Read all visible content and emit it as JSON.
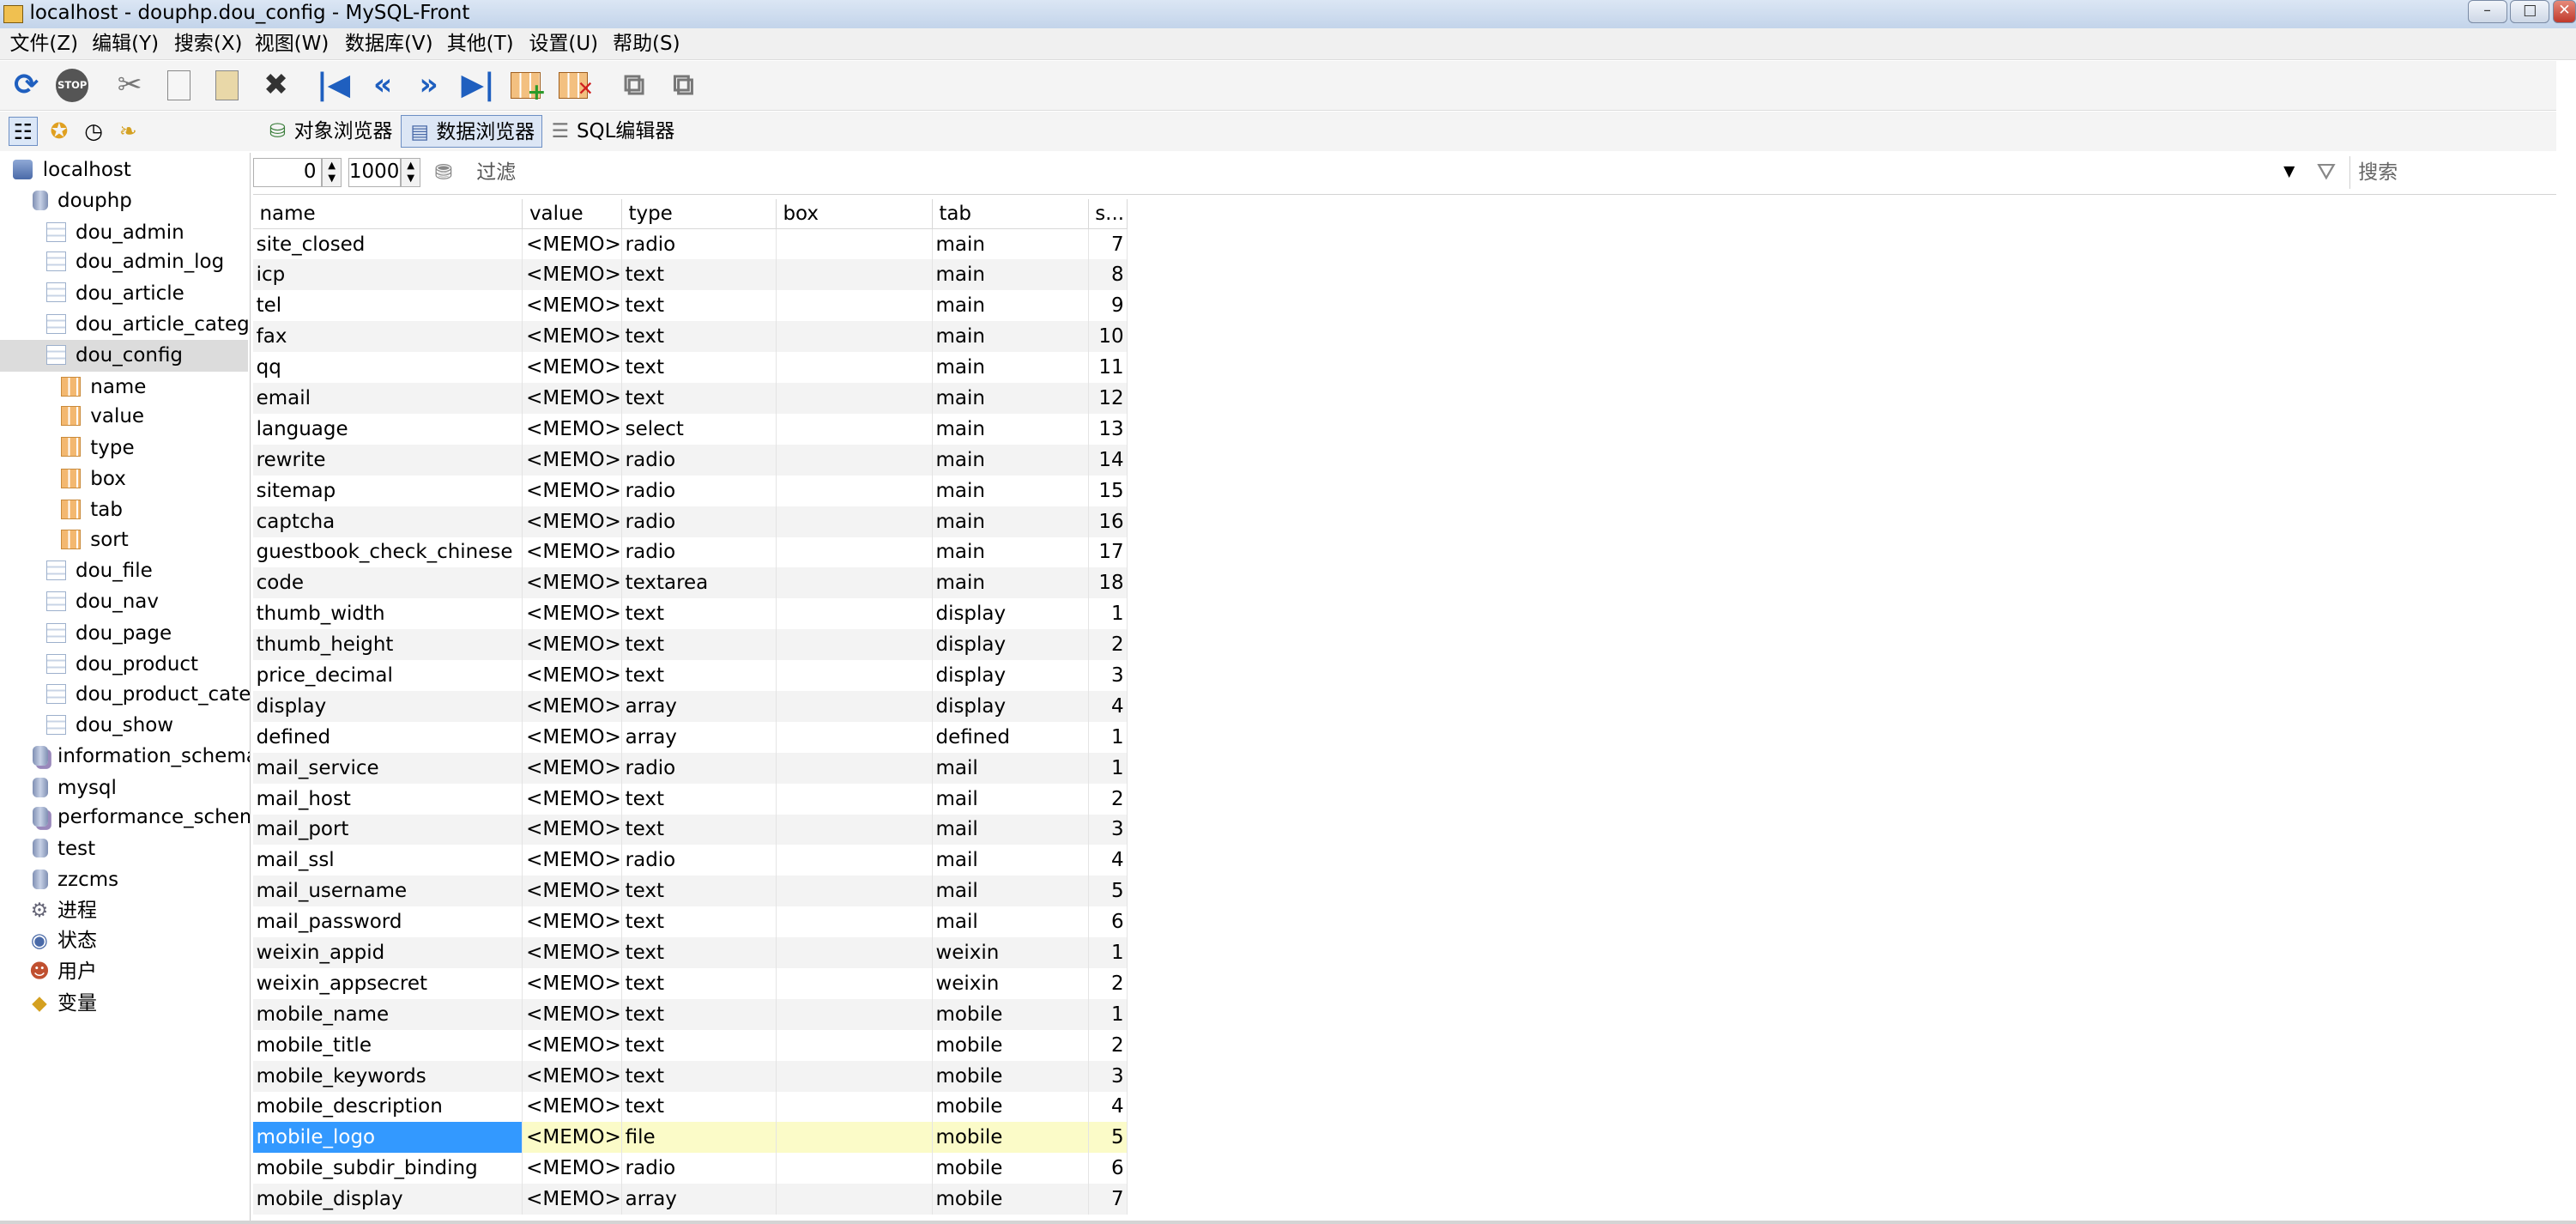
{
  "window": {
    "title": "localhost - douphp.dou_config - MySQL-Front"
  },
  "menu": [
    "文件(Z)",
    "编辑(Y)",
    "搜索(X)",
    "视图(W)",
    "数据库(V)",
    "其他(T)",
    "设置(U)",
    "帮助(S)"
  ],
  "toolbar": {
    "stop_label": "STOP"
  },
  "views": {
    "object_browser": "对象浏览器",
    "data_browser": "数据浏览器",
    "sql_editor": "SQL编辑器"
  },
  "tree": {
    "server": "localhost",
    "database": "douphp",
    "tables": [
      "dou_admin",
      "dou_admin_log",
      "dou_article",
      "dou_article_categor",
      "dou_config"
    ],
    "fields": [
      "name",
      "value",
      "type",
      "box",
      "tab",
      "sort"
    ],
    "tables_after": [
      "dou_file",
      "dou_nav",
      "dou_page",
      "dou_product",
      "dou_product_categ",
      "dou_show"
    ],
    "databases": [
      "information_schema",
      "mysql",
      "performance_schema",
      "test",
      "zzcms"
    ],
    "system": [
      "进程",
      "状态",
      "用户",
      "变量"
    ]
  },
  "filterbar": {
    "offset": "0",
    "limit": "1000",
    "filter_placeholder": "过滤",
    "search_placeholder": "搜索"
  },
  "grid": {
    "columns": [
      "name",
      "value",
      "type",
      "box",
      "tab",
      "s..."
    ],
    "rows": [
      [
        "site_closed",
        "<MEMO>",
        "radio",
        "",
        "main",
        "7"
      ],
      [
        "icp",
        "<MEMO>",
        "text",
        "",
        "main",
        "8"
      ],
      [
        "tel",
        "<MEMO>",
        "text",
        "",
        "main",
        "9"
      ],
      [
        "fax",
        "<MEMO>",
        "text",
        "",
        "main",
        "10"
      ],
      [
        "qq",
        "<MEMO>",
        "text",
        "",
        "main",
        "11"
      ],
      [
        "email",
        "<MEMO>",
        "text",
        "",
        "main",
        "12"
      ],
      [
        "language",
        "<MEMO>",
        "select",
        "",
        "main",
        "13"
      ],
      [
        "rewrite",
        "<MEMO>",
        "radio",
        "",
        "main",
        "14"
      ],
      [
        "sitemap",
        "<MEMO>",
        "radio",
        "",
        "main",
        "15"
      ],
      [
        "captcha",
        "<MEMO>",
        "radio",
        "",
        "main",
        "16"
      ],
      [
        "guestbook_check_chinese",
        "<MEMO>",
        "radio",
        "",
        "main",
        "17"
      ],
      [
        "code",
        "<MEMO>",
        "textarea",
        "",
        "main",
        "18"
      ],
      [
        "thumb_width",
        "<MEMO>",
        "text",
        "",
        "display",
        "1"
      ],
      [
        "thumb_height",
        "<MEMO>",
        "text",
        "",
        "display",
        "2"
      ],
      [
        "price_decimal",
        "<MEMO>",
        "text",
        "",
        "display",
        "3"
      ],
      [
        "display",
        "<MEMO>",
        "array",
        "",
        "display",
        "4"
      ],
      [
        "defined",
        "<MEMO>",
        "array",
        "",
        "defined",
        "1"
      ],
      [
        "mail_service",
        "<MEMO>",
        "radio",
        "",
        "mail",
        "1"
      ],
      [
        "mail_host",
        "<MEMO>",
        "text",
        "",
        "mail",
        "2"
      ],
      [
        "mail_port",
        "<MEMO>",
        "text",
        "",
        "mail",
        "3"
      ],
      [
        "mail_ssl",
        "<MEMO>",
        "radio",
        "",
        "mail",
        "4"
      ],
      [
        "mail_username",
        "<MEMO>",
        "text",
        "",
        "mail",
        "5"
      ],
      [
        "mail_password",
        "<MEMO>",
        "text",
        "",
        "mail",
        "6"
      ],
      [
        "weixin_appid",
        "<MEMO>",
        "text",
        "",
        "weixin",
        "1"
      ],
      [
        "weixin_appsecret",
        "<MEMO>",
        "text",
        "",
        "weixin",
        "2"
      ],
      [
        "mobile_name",
        "<MEMO>",
        "text",
        "",
        "mobile",
        "1"
      ],
      [
        "mobile_title",
        "<MEMO>",
        "text",
        "",
        "mobile",
        "2"
      ],
      [
        "mobile_keywords",
        "<MEMO>",
        "text",
        "",
        "mobile",
        "3"
      ],
      [
        "mobile_description",
        "<MEMO>",
        "text",
        "",
        "mobile",
        "4"
      ],
      [
        "mobile_logo",
        "<MEMO>",
        "file",
        "",
        "mobile",
        "5"
      ],
      [
        "mobile_subdir_binding",
        "<MEMO>",
        "radio",
        "",
        "mobile",
        "6"
      ],
      [
        "mobile_display",
        "<MEMO>",
        "array",
        "",
        "mobile",
        "7"
      ]
    ]
  },
  "colors": {
    "selection": "#3399ff",
    "focused_row": "#fbfbc8",
    "toolbar_blue": "#1f5fbf"
  }
}
